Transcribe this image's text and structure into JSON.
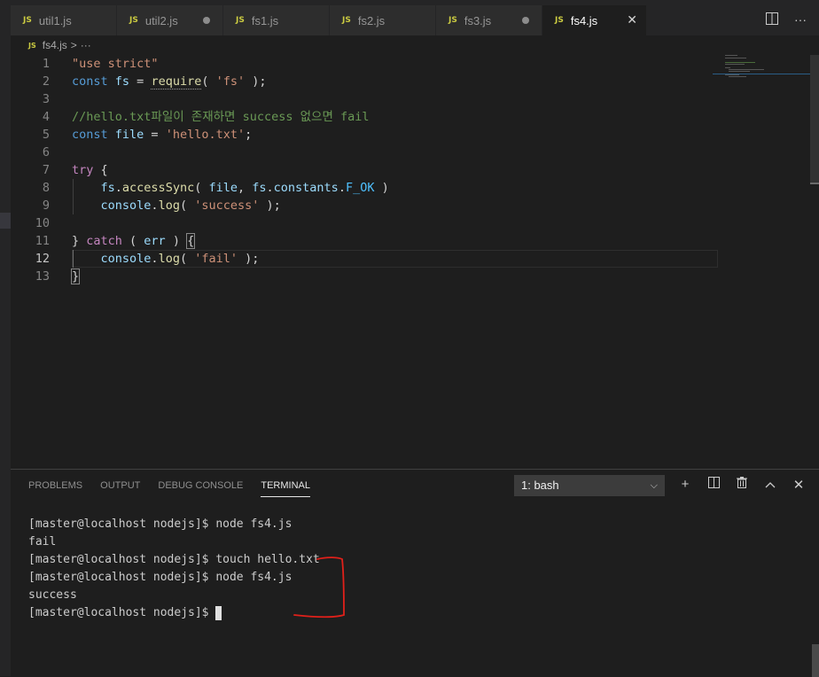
{
  "tabs": [
    {
      "name": "util1.js",
      "badge": "JS",
      "dirty": false
    },
    {
      "name": "util2.js",
      "badge": "JS",
      "dirty": true
    },
    {
      "name": "fs1.js",
      "badge": "JS",
      "dirty": false
    },
    {
      "name": "fs2.js",
      "badge": "JS",
      "dirty": false
    },
    {
      "name": "fs3.js",
      "badge": "JS",
      "dirty": true
    },
    {
      "name": "fs4.js",
      "badge": "JS",
      "active": true
    }
  ],
  "tab_actions": {
    "split_icon": "split-editor-icon",
    "more": "···",
    "close": "✕"
  },
  "breadcrumb": {
    "badge": "JS",
    "file": "fs4.js",
    "sep": ">",
    "more": "···"
  },
  "editor": {
    "line_numbers": [
      "1",
      "2",
      "3",
      "4",
      "5",
      "6",
      "7",
      "8",
      "9",
      "10",
      "11",
      "12",
      "13"
    ],
    "current_line": "12",
    "comment_line": "//hello.txt파일이 존재하면 success 없으면 fail"
  },
  "panel": {
    "tabs": [
      "PROBLEMS",
      "OUTPUT",
      "DEBUG CONSOLE",
      "TERMINAL"
    ],
    "active_tab": "TERMINAL",
    "terminal_selector": "1: bash",
    "actions": {
      "add": "+",
      "split": "split-terminal-icon",
      "trash": "trash-icon",
      "maximize": "chevron-up-icon",
      "close": "✕"
    }
  },
  "terminal": {
    "lines": [
      "[master@localhost nodejs]$ node fs4.js",
      "fail",
      "[master@localhost nodejs]$ touch hello.txt",
      "[master@localhost nodejs]$ node fs4.js",
      "success"
    ],
    "prompt": "[master@localhost nodejs]$ "
  },
  "colors": {
    "background": "#1e1e1e",
    "tabbar": "#252526",
    "js_badge": "#cbcb41",
    "annotation": "#e0201a"
  }
}
